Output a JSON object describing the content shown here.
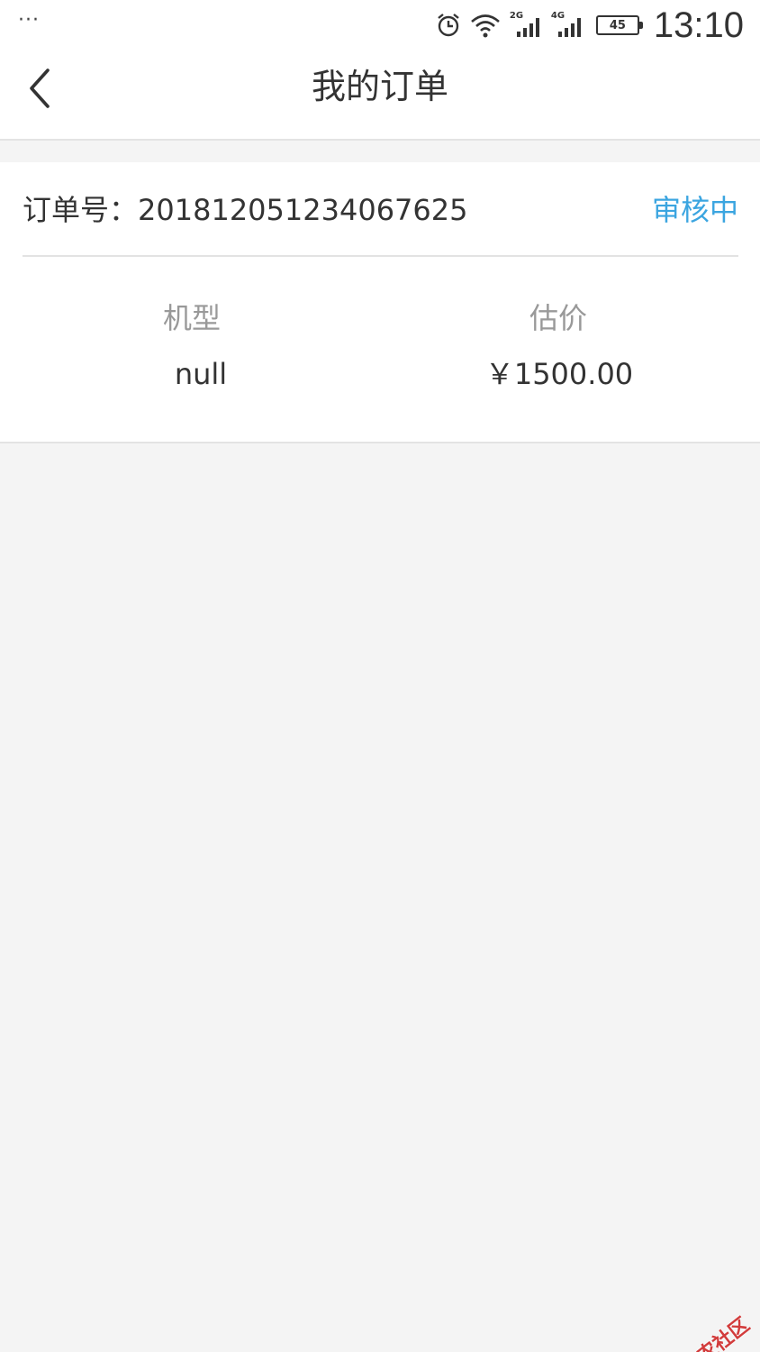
{
  "status_bar": {
    "dots": "···",
    "net1": "2G",
    "net2": "4G",
    "battery": "45",
    "time": "13:10"
  },
  "nav": {
    "title": "我的订单"
  },
  "order": {
    "order_no_label": "订单号：",
    "order_no": "201812051234067625",
    "status": "审核中",
    "model_label": "机型",
    "model_value": "null",
    "price_label": "估价",
    "price_value": "￥1500.00",
    "status_color": "#3ba5e0"
  },
  "watermark": {
    "text": "卡农社区"
  },
  "icons": [
    "alarm-icon",
    "wifi-icon",
    "signal-icon",
    "back-chevron-icon",
    "watermark-logo-icon"
  ]
}
